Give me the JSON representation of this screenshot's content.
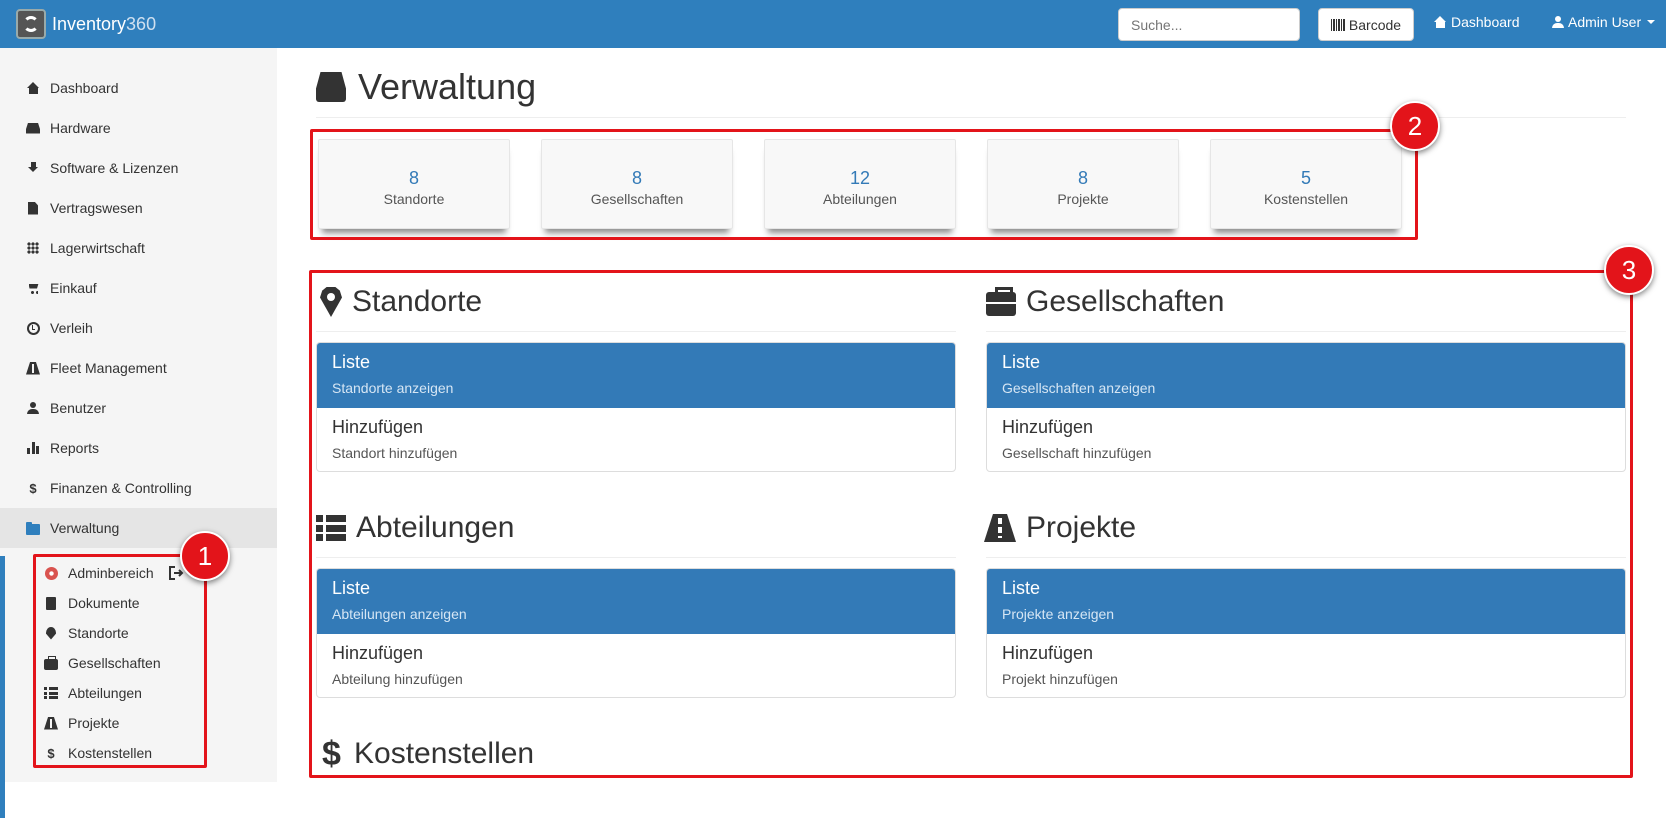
{
  "app": {
    "brand_name": "Inventory",
    "brand_number": "360",
    "accent_color": "#2f7fbd"
  },
  "navbar": {
    "search_placeholder": "Suche...",
    "barcode_label": "Barcode",
    "dashboard_label": "Dashboard",
    "user_label": "Admin User"
  },
  "sidebar": {
    "items": [
      {
        "label": "Dashboard",
        "icon": "home-icon"
      },
      {
        "label": "Hardware",
        "icon": "hdd-icon"
      },
      {
        "label": "Software & Lizenzen",
        "icon": "download-icon"
      },
      {
        "label": "Vertragswesen",
        "icon": "file-icon"
      },
      {
        "label": "Lagerwirtschaft",
        "icon": "grid-icon"
      },
      {
        "label": "Einkauf",
        "icon": "cart-icon"
      },
      {
        "label": "Verleih",
        "icon": "clock-icon"
      },
      {
        "label": "Fleet Management",
        "icon": "road-icon"
      },
      {
        "label": "Benutzer",
        "icon": "user-icon"
      },
      {
        "label": "Reports",
        "icon": "bar-chart-icon"
      },
      {
        "label": "Finanzen & Controlling",
        "icon": "dollar-icon"
      },
      {
        "label": "Verwaltung",
        "icon": "folder-icon"
      }
    ],
    "subitems": [
      {
        "label": "Adminbereich",
        "icon": "gear-icon"
      },
      {
        "label": "Dokumente",
        "icon": "book-icon"
      },
      {
        "label": "Standorte",
        "icon": "map-marker-icon"
      },
      {
        "label": "Gesellschaften",
        "icon": "briefcase-icon"
      },
      {
        "label": "Abteilungen",
        "icon": "list-icon"
      },
      {
        "label": "Projekte",
        "icon": "road-icon"
      },
      {
        "label": "Kostenstellen",
        "icon": "dollar-icon"
      }
    ]
  },
  "main": {
    "title": "Verwaltung",
    "stats": [
      {
        "value": "8",
        "label": "Standorte"
      },
      {
        "value": "8",
        "label": "Gesellschaften"
      },
      {
        "value": "12",
        "label": "Abteilungen"
      },
      {
        "value": "8",
        "label": "Projekte"
      },
      {
        "value": "5",
        "label": "Kostenstellen"
      }
    ],
    "sections": [
      {
        "title": "Standorte",
        "list_title": "Liste",
        "list_sub": "Standorte anzeigen",
        "add_title": "Hinzufügen",
        "add_sub": "Standort hinzufügen"
      },
      {
        "title": "Gesellschaften",
        "list_title": "Liste",
        "list_sub": "Gesellschaften anzeigen",
        "add_title": "Hinzufügen",
        "add_sub": "Gesellschaft hinzufügen"
      },
      {
        "title": "Abteilungen",
        "list_title": "Liste",
        "list_sub": "Abteilungen anzeigen",
        "add_title": "Hinzufügen",
        "add_sub": "Abteilung hinzufügen"
      },
      {
        "title": "Projekte",
        "list_title": "Liste",
        "list_sub": "Projekte anzeigen",
        "add_title": "Hinzufügen",
        "add_sub": "Projekt hinzufügen"
      },
      {
        "title": "Kostenstellen"
      }
    ]
  },
  "annotations": {
    "markers": [
      "1",
      "2",
      "3"
    ],
    "color": "#e3141a"
  }
}
